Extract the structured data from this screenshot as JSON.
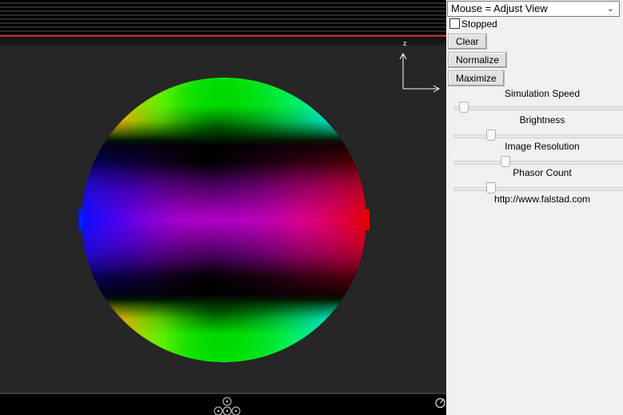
{
  "toolbar": {
    "mouse_mode": "Mouse = Adjust View",
    "stopped_label": "Stopped",
    "stopped_checked": false,
    "clear_label": "Clear",
    "normalize_label": "Normalize",
    "maximize_label": "Maximize"
  },
  "sliders": {
    "simulation_speed": {
      "label": "Simulation Speed",
      "value": 0.03
    },
    "brightness": {
      "label": "Brightness",
      "value": 0.2
    },
    "image_resolution": {
      "label": "Image Resolution",
      "value": 0.29
    },
    "phasor_count": {
      "label": "Phasor Count",
      "value": 0.2
    }
  },
  "footer": {
    "url": "http://www.falstad.com"
  },
  "viewport": {
    "axis_label": "z",
    "colors": {
      "background": "#262626",
      "band_green": "#00e000",
      "band_magenta": "#b000c8",
      "edge_red": "#e00000",
      "edge_blue": "#0020ff",
      "edge_cyan": "#00e8ff",
      "edge_yellow": "#ffc800"
    }
  },
  "icons": [
    "chevron-down-icon",
    "axes-icon",
    "navigation-icon",
    "rotate-icon"
  ]
}
